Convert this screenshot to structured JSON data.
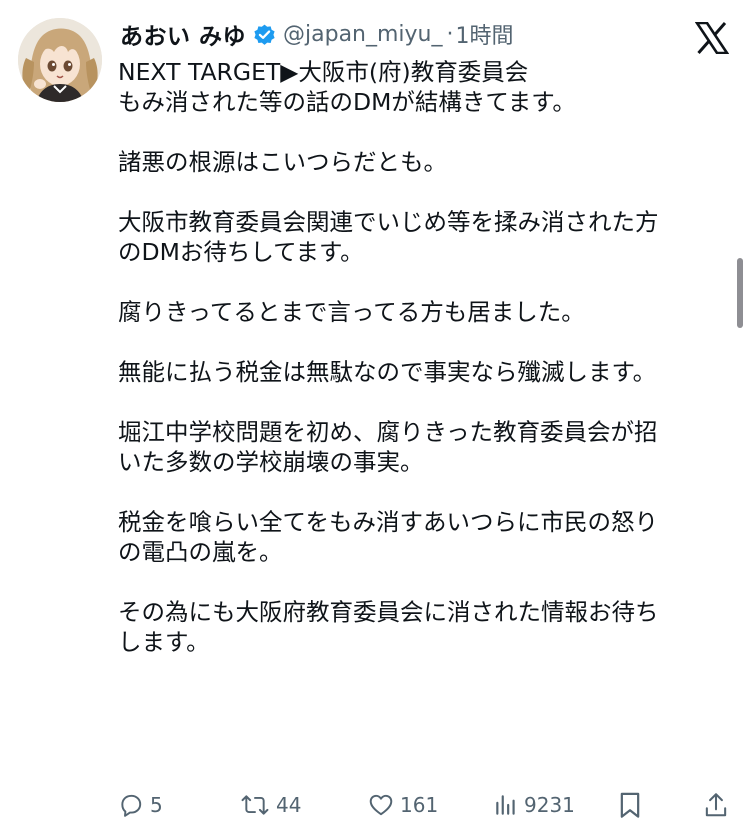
{
  "tweet": {
    "author_name": "あおい みゆ",
    "handle": "@japan_miyu_",
    "separator": "·",
    "time": "1時間",
    "paragraphs": [
      [
        "NEXT TARGET▶大阪市(府)教育委員会",
        "もみ消された等の話のDMが結構きてます。"
      ],
      [
        "諸悪の根源はこいつらだとも。"
      ],
      [
        "大阪市教育委員会関連でいじめ等を揉み消された方",
        "のDMお待ちしてます。"
      ],
      [
        "腐りきってるとまで言ってる方も居ました。"
      ],
      [
        "無能に払う税金は無駄なので事実なら殲滅します。"
      ],
      [
        "堀江中学校問題を初め、腐りきった教育委員会が招",
        "いた多数の学校崩壊の事実。"
      ],
      [
        "税金を喰らい全てをもみ消すあいつらに市民の怒り",
        "の電凸の嵐を。"
      ],
      [
        "その為にも大阪府教育委員会に消された情報お待ち",
        "します。"
      ]
    ],
    "icons": {
      "avatar": "anime-girl-avatar",
      "verified": "verified-badge-icon",
      "platform": "x-logo-icon"
    }
  },
  "actions": {
    "replies": "5",
    "reposts": "44",
    "likes": "161",
    "views": "9231",
    "bookmark_icon": "bookmark-icon",
    "share_icon": "share-icon"
  },
  "colors": {
    "text": "#0f1419",
    "secondary": "#536471",
    "verified": "#1d9bf0",
    "background": "#ffffff"
  }
}
